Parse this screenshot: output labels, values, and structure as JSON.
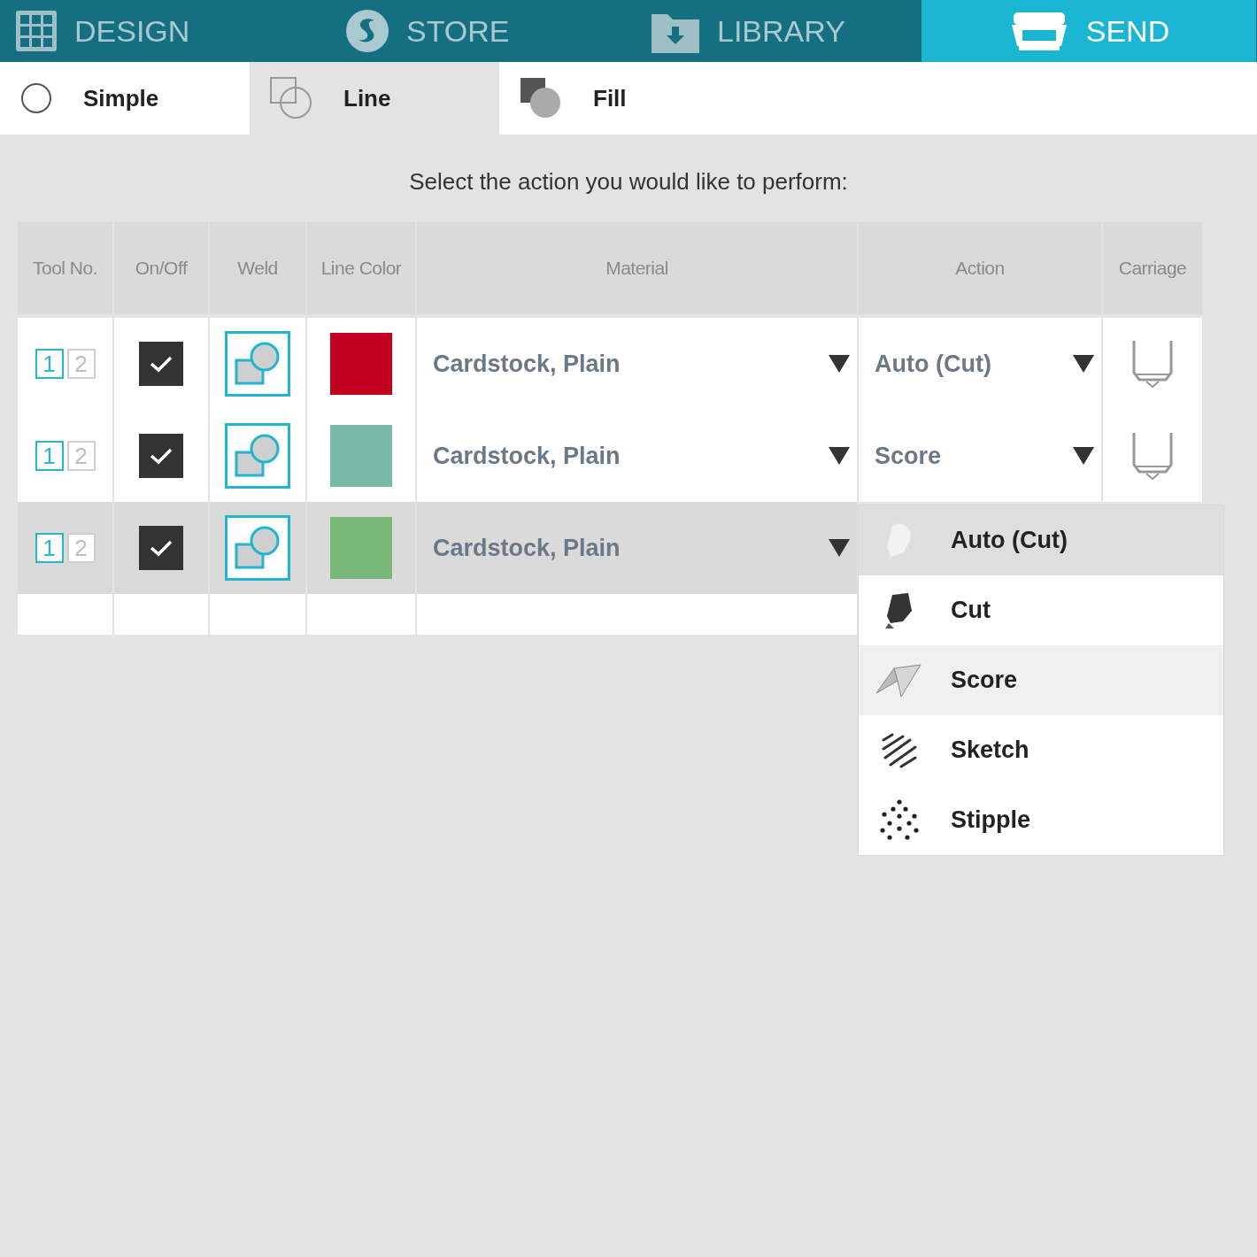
{
  "nav_tabs": [
    {
      "label": "DESIGN",
      "kind": "grid",
      "selected": false
    },
    {
      "label": "STORE",
      "kind": "store",
      "selected": false
    },
    {
      "label": "LIBRARY",
      "kind": "folder",
      "selected": false
    },
    {
      "label": "SEND",
      "kind": "cutter",
      "selected": true
    }
  ],
  "mode_tabs": [
    {
      "label": "Simple",
      "kind": "simple",
      "selected": false
    },
    {
      "label": "Line",
      "kind": "line",
      "selected": true
    },
    {
      "label": "Fill",
      "kind": "fill",
      "selected": false
    }
  ],
  "instruction": "Select the action you would like to perform:",
  "table": {
    "columns": [
      "Tool No.",
      "On/Off",
      "Weld",
      "Line Color",
      "Material",
      "Action",
      "Carriage"
    ],
    "rows": [
      {
        "tools": [
          {
            "label": "1",
            "selected": true
          },
          {
            "label": "2",
            "selected": false
          }
        ],
        "on": true,
        "weld": true,
        "color": "#c0001e",
        "material": "Cardstock, Plain",
        "action": "Auto (Cut)",
        "selected": false
      },
      {
        "tools": [
          {
            "label": "1",
            "selected": true
          },
          {
            "label": "2",
            "selected": false
          }
        ],
        "on": true,
        "weld": true,
        "color": "#7ab8a8",
        "material": "Cardstock, Plain",
        "action": "Score",
        "selected": false
      },
      {
        "tools": [
          {
            "label": "1",
            "selected": true
          },
          {
            "label": "2",
            "selected": false
          }
        ],
        "on": true,
        "weld": true,
        "color": "#78b878",
        "material": "Cardstock, Plain",
        "selected": true
      }
    ]
  },
  "action_menu": {
    "items": [
      {
        "label": "Auto (Cut)",
        "kind": "auto",
        "selected": true,
        "hovered": false
      },
      {
        "label": "Cut",
        "kind": "cut",
        "selected": false,
        "hovered": false
      },
      {
        "label": "Score",
        "kind": "score",
        "selected": false,
        "hovered": true
      },
      {
        "label": "Sketch",
        "kind": "sketch",
        "selected": false,
        "hovered": false
      },
      {
        "label": "Stipple",
        "kind": "stipple",
        "selected": false,
        "hovered": false
      }
    ]
  }
}
